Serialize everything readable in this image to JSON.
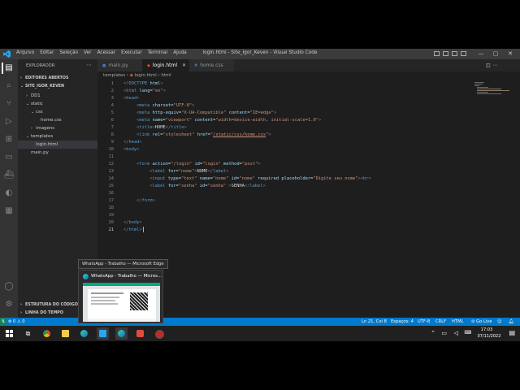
{
  "window": {
    "menu": [
      "Arquivo",
      "Editar",
      "Seleção",
      "Ver",
      "Acessar",
      "Executar",
      "Terminal",
      "Ajuda"
    ],
    "title": "login.html - Site_Igor_Keven - Visual Studio Code",
    "controls": {
      "minimize": "—",
      "maximize": "▢",
      "close": "✕"
    }
  },
  "activity_bar": [
    "files-icon",
    "search-icon",
    "source-control-icon",
    "run-debug-icon",
    "extensions-icon",
    "remote-icon",
    "docker-icon",
    "edge-icon",
    "notes-icon",
    "account-icon",
    "settings-gear-icon"
  ],
  "sidebar": {
    "header": "EXPLORADOR",
    "open_editors": "EDITORES ABERTOS",
    "project": "SITE_IGOR_KEVEN",
    "tree": [
      {
        "label": "DD1",
        "indent": 1,
        "chev": "›"
      },
      {
        "label": "static",
        "indent": 1,
        "chev": "⌄"
      },
      {
        "label": "css",
        "indent": 2,
        "chev": "⌄"
      },
      {
        "label": "home.css",
        "indent": 3,
        "chev": ""
      },
      {
        "label": "imagens",
        "indent": 2,
        "chev": "›"
      },
      {
        "label": "templates",
        "indent": 1,
        "chev": "⌄"
      },
      {
        "label": "login.html",
        "indent": 2,
        "chev": "",
        "selected": true
      },
      {
        "label": "main.py",
        "indent": 1,
        "chev": ""
      }
    ],
    "outline": "ESTRUTURA DO CÓDIGO",
    "timeline": "LINHA DO TEMPO"
  },
  "tabs": [
    {
      "label": "main.py",
      "icon": "python-file-icon",
      "active": false
    },
    {
      "label": "login.html",
      "icon": "html-file-icon",
      "active": true
    },
    {
      "label": "home.css",
      "icon": "css-file-icon",
      "active": false
    }
  ],
  "breadcrumb": [
    "templates",
    "login.html",
    "html"
  ],
  "editor": {
    "line_count": 21,
    "current_line": 21
  },
  "status": {
    "errors": "⊗ 0 ⚠ 0",
    "position": "Ln 21, Col 8",
    "spaces": "Espaços: 4",
    "encoding": "UTF-8",
    "eol": "CRLF",
    "language": "HTML",
    "golive": "⊘ Go Live"
  },
  "taskbar": {
    "time": "17:03",
    "date": "07/11/2022",
    "tooltip": "WhatsApp - Trabalho — Microsoft Edge",
    "thumbnail_title": "WhatsApp - Trabalho — Micros..."
  },
  "colors": {
    "accent": "#007acc",
    "tag": "#569cd6",
    "attr": "#9cdcfe",
    "string": "#ce9178"
  }
}
